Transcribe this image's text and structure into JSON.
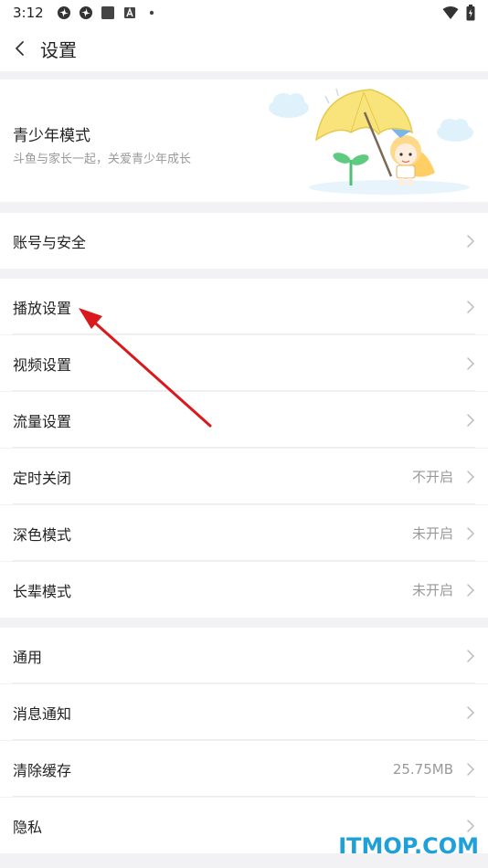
{
  "status_bar": {
    "time": "3:12",
    "icons": [
      "pinwheel-icon",
      "pinwheel-icon",
      "square-icon",
      "app-a-icon",
      "dot-icon"
    ],
    "right_icons": [
      "wifi-icon",
      "battery-icon"
    ]
  },
  "header": {
    "title": "设置"
  },
  "teen_mode": {
    "title": "青少年模式",
    "subtitle": "斗鱼与家长一起，关爱青少年成长"
  },
  "groups": [
    {
      "items": [
        {
          "label": "账号与安全",
          "value": ""
        }
      ]
    },
    {
      "items": [
        {
          "label": "播放设置",
          "value": ""
        },
        {
          "label": "视频设置",
          "value": ""
        },
        {
          "label": "流量设置",
          "value": ""
        },
        {
          "label": "定时关闭",
          "value": "不开启"
        },
        {
          "label": "深色模式",
          "value": "未开启"
        },
        {
          "label": "长辈模式",
          "value": "未开启"
        }
      ]
    },
    {
      "items": [
        {
          "label": "通用",
          "value": ""
        },
        {
          "label": "消息通知",
          "value": ""
        },
        {
          "label": "清除缓存",
          "value": "25.75MB"
        },
        {
          "label": "隐私",
          "value": ""
        }
      ]
    }
  ],
  "watermark": "ITMOP.COM",
  "colors": {
    "annotation_arrow": "#d9191c",
    "watermark": "#1fa0d8",
    "background": "#f2f2f4"
  }
}
